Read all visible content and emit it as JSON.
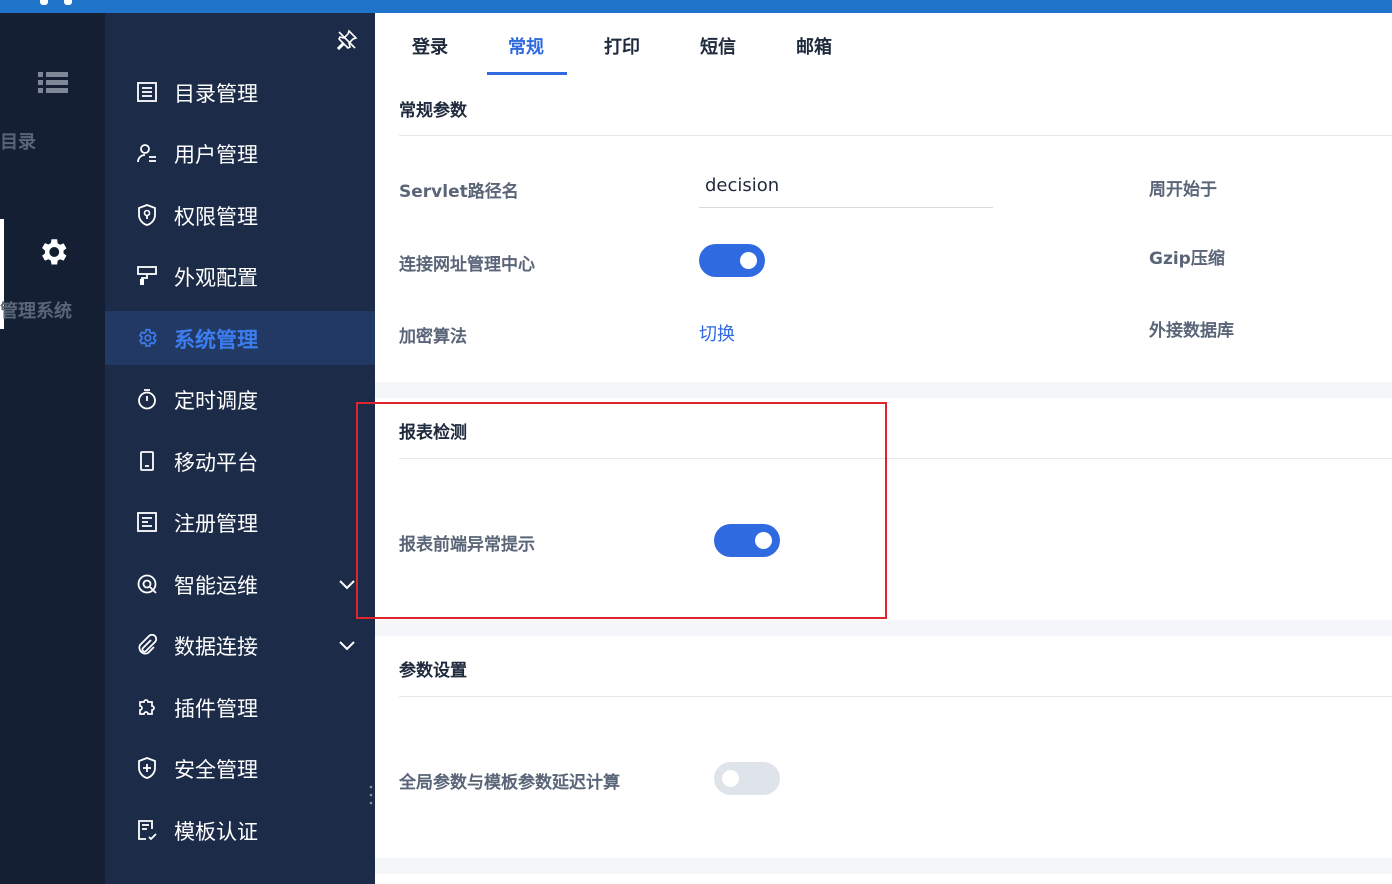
{
  "rail": {
    "items": [
      {
        "label": "目录",
        "icon": "list-icon"
      },
      {
        "label": "管理系统",
        "icon": "gear-icon"
      }
    ]
  },
  "nav": {
    "items": [
      {
        "label": "目录管理",
        "icon": "catalog-icon"
      },
      {
        "label": "用户管理",
        "icon": "user-icon"
      },
      {
        "label": "权限管理",
        "icon": "shield-lock-icon"
      },
      {
        "label": "外观配置",
        "icon": "brush-icon"
      },
      {
        "label": "系统管理",
        "icon": "gear-icon"
      },
      {
        "label": "定时调度",
        "icon": "stopwatch-icon"
      },
      {
        "label": "移动平台",
        "icon": "mobile-icon"
      },
      {
        "label": "注册管理",
        "icon": "register-icon"
      },
      {
        "label": "智能运维",
        "icon": "ops-icon"
      },
      {
        "label": "数据连接",
        "icon": "paperclip-icon"
      },
      {
        "label": "插件管理",
        "icon": "puzzle-icon"
      },
      {
        "label": "安全管理",
        "icon": "shield-plus-icon"
      },
      {
        "label": "模板认证",
        "icon": "template-cert-icon"
      }
    ]
  },
  "tabs": [
    "登录",
    "常规",
    "打印",
    "短信",
    "邮箱"
  ],
  "general": {
    "title": "常规参数",
    "servlet_label": "Servlet路径名",
    "servlet_value": "decision",
    "connect_label": "连接网址管理中心",
    "encrypt_label": "加密算法",
    "encrypt_link": "切换",
    "week_label": "周开始于",
    "gzip_label": "Gzip压缩",
    "external_db_label": "外接数据库"
  },
  "report_check": {
    "title": "报表检测",
    "frontend_alert_label": "报表前端异常提示"
  },
  "params": {
    "title": "参数设置",
    "delay_label": "全局参数与模板参数延迟计算"
  },
  "toggles": {
    "connect": true,
    "frontend_alert": true,
    "delay": false
  },
  "colors": {
    "accent": "#2f6ae0",
    "nav_bg": "#1c2b48",
    "rail_bg": "#151f33",
    "highlight": "#e0242e"
  }
}
